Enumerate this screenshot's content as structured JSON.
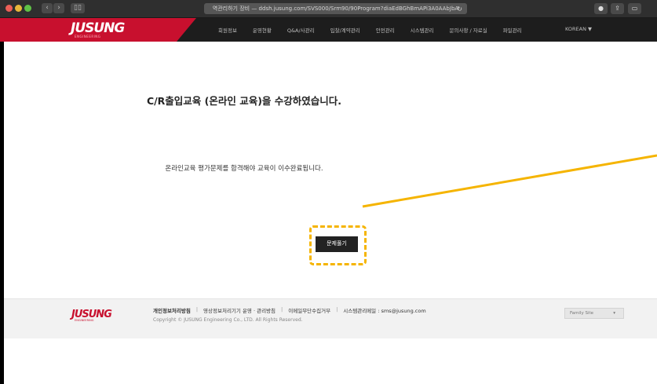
{
  "browser": {
    "address": "역관리하기 장비 — ddsh.jusung.com/SVS000/Srm90/90Program?diaEdBGhBmAPi3A0AAbJbA",
    "back_icon": "chevron-left-icon",
    "forward_icon": "chevron-right-icon",
    "sidebar_icon": "sidebar-icon",
    "reload_icon": "reload-icon",
    "right_buttons": [
      "download-icon",
      "share-icon",
      "tabs-icon"
    ]
  },
  "header": {
    "logo": "JUSUNG",
    "logo_sub": "ENGINEERING",
    "nav": [
      "회원정보",
      "운영현황",
      "Q&A/사관리",
      "입찰/계약관리",
      "안전관리",
      "시스템관리",
      "문의사항 / 자료실",
      "파일관리"
    ],
    "lang": "KOREAN ▼",
    "brand_color": "#c8102e"
  },
  "main": {
    "heading": "C/R출입교육 (온라인 교육)을 수강하였습니다.",
    "info": "온라인교육 평가문제를 합격해야 교육이 이수완료됩니다.",
    "button": "문제풀기",
    "highlight_color": "#f5b400"
  },
  "footer": {
    "logo": "JUSUNG",
    "logo_sub": "ENGINEERING",
    "links": [
      "개인정보처리방침",
      "영상정보처리기기 운영 · 관리방침",
      "이메일무단수집거부",
      "시스템관리메일 : sms@jusung.com"
    ],
    "copyright": "Copyright © JUSUNG Engineering Co., LTD. All Rights Reserved.",
    "family_site": "Family Site"
  }
}
